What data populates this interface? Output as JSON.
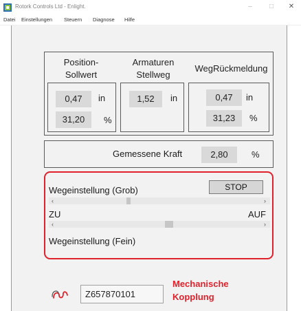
{
  "window": {
    "title": "Rotork Controls Ltd - Enlight.",
    "controls": {
      "minimize": "–",
      "maximize": "□",
      "close": "✕"
    }
  },
  "menu": {
    "items": [
      "Datei",
      "Einstellungen",
      "Steuern",
      "Diagnose",
      "Hilfe"
    ]
  },
  "position": {
    "setpoint_header_line1": "Position-",
    "setpoint_header_line2": "Sollwert",
    "travel_header_line1": "Armaturen",
    "travel_header_line2": "Stellweg",
    "feedback_header": "WegRückmeldung",
    "setpoint_in": "0,47",
    "setpoint_percent": "31,20",
    "travel_in": "1,52",
    "feedback_in": "0,47",
    "feedback_percent": "31,23",
    "unit_in": "in",
    "unit_percent": "%"
  },
  "force": {
    "label": "Gemessene Kraft",
    "value": "2,80",
    "unit": "%"
  },
  "adjustment": {
    "coarse_label": "Wegeinstellung (Grob)",
    "fine_label": "Wegeinstellung (Fein)",
    "stop_button": "STOP",
    "left_end": "ZU",
    "right_end": "AUF",
    "scroll_left": "‹",
    "scroll_right": "›",
    "coarse_position": 0.35,
    "fine_position": 0.55
  },
  "coupling": {
    "icon": "coupling-icon",
    "id": "Z657870101",
    "label_line1": "Mechanische",
    "label_line2": "Kopplung",
    "accent": "#e0212b"
  }
}
